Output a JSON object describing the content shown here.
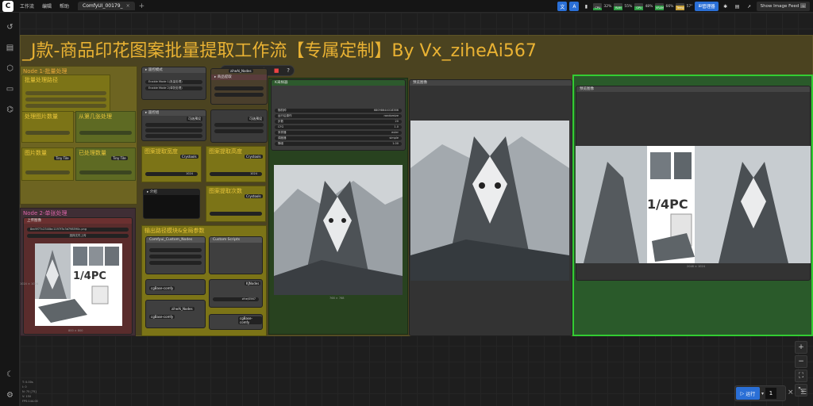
{
  "topbar": {
    "logo": "C",
    "menus": [
      "工作流",
      "编辑",
      "帮助"
    ],
    "tab": "ComfyUI_00179_",
    "tab_close": "×",
    "new_tab": "+",
    "gauges": [
      {
        "label": "CPU",
        "value": "32%",
        "level": 0.32
      },
      {
        "label": "RAM",
        "value": "55%",
        "level": 0.55
      },
      {
        "label": "GPU",
        "value": "48%",
        "level": 0.48
      },
      {
        "label": "VRAM",
        "value": "66%",
        "level": 0.66
      },
      {
        "label": "Temp",
        "value": "57°",
        "level": 0.57
      }
    ],
    "manager": "管理器",
    "feed": "Show Image Feed"
  },
  "sidebar": {
    "icons": [
      "history-icon",
      "queue-icon",
      "node-library-icon",
      "models-icon",
      "workflows-icon"
    ],
    "bottom_icons": [
      "theme-icon",
      "settings-icon"
    ],
    "stats": [
      "T: 0.00s",
      "I: 0",
      "N: 75 [75]",
      "V: 150",
      "FPS:144.00"
    ]
  },
  "canvas": {
    "title": "_J款-商品印花图案批量提取工作流【专属定制】By Vx_ziheAi567",
    "groups": [
      {
        "label": "Node 1-批量处理"
      },
      {
        "label": "批量处理路径"
      },
      {
        "label": "处理图片数量"
      },
      {
        "label": "从第几张处理"
      },
      {
        "label": "图片数量"
      },
      {
        "label": "已处理数量"
      },
      {
        "label": "Node 2-单张处理"
      },
      {
        "label": "图案提取宽度"
      },
      {
        "label": "图案提取高度"
      },
      {
        "label": "图案提取次数"
      },
      {
        "label": "输出路径模块&全局参数"
      }
    ],
    "nodes": {
      "node_1": "K采样器",
      "node_2": "预览图像",
      "node_3": "预览图像",
      "wf_image_label": "1/4PC",
      "image_sizes": [
        "768 × 768",
        "1024 × 1024",
        "2048 × 1024",
        "800 × 800"
      ],
      "sampler_fields": [
        {
          "label": "随机种",
          "value": "68098644018386"
        },
        {
          "label": "运行后操作",
          "value": "randomize"
        },
        {
          "label": "步数",
          "value": "20"
        },
        {
          "label": "CFG",
          "value": "1.0"
        },
        {
          "label": "采样器",
          "value": "euler"
        },
        {
          "label": "调度器",
          "value": "simple"
        },
        {
          "label": "降噪",
          "value": "1.00"
        }
      ],
      "load_image": "上传图像",
      "file_value": "8ec9f77c2340bc1197f3c3d798590c.png",
      "choose_file": "选择文件上传",
      "num_width": "1024",
      "num_height": "1024",
      "badge_crystools": "Crystools",
      "badge_ziheai": "ziheAi_Nodes",
      "badge_kjnodes": "KJNodes",
      "badge_comfy": "cgBase-comfy",
      "badge_tiny": "Tiny Tile",
      "text_input": "zihe/0567",
      "mode_a": "Enable Mode 1(批量处理)",
      "mode_b": "Enable Mode 2(单张处理)",
      "flags": "可选预设"
    }
  },
  "runbar": {
    "label": "运行",
    "count": "1"
  }
}
